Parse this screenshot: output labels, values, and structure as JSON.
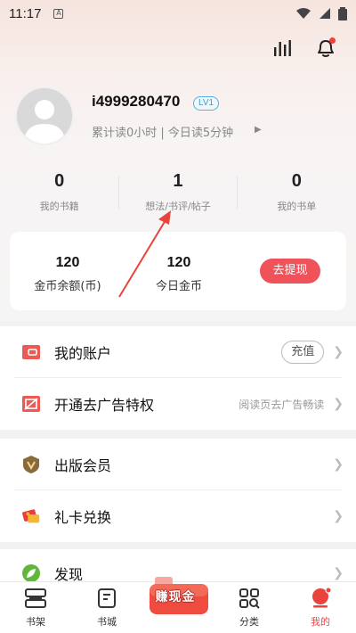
{
  "status_bar": {
    "time": "11:17",
    "indicator": "A"
  },
  "header": {
    "stats_icon": "bar-chart-icon",
    "bell_icon": "bell-icon"
  },
  "profile": {
    "username": "i4999280470",
    "level": "LV1",
    "read_info": "累计读0小时 | 今日读5分钟",
    "avatar_icon": "default-avatar"
  },
  "stats": [
    {
      "value": "0",
      "label": "我的书籍"
    },
    {
      "value": "1",
      "label": "想法/书评/帖子"
    },
    {
      "value": "0",
      "label": "我的书单"
    }
  ],
  "coins": {
    "balance_value": "120",
    "balance_label": "金币余额(币)",
    "today_value": "120",
    "today_label": "今日金币",
    "withdraw_label": "去提现"
  },
  "menu": {
    "group1": [
      {
        "label": "我的账户",
        "action": "充值",
        "icon": "wallet-icon"
      },
      {
        "label": "开通去广告特权",
        "hint": "阅读页去广告畅读",
        "icon": "no-ads-icon"
      }
    ],
    "group2": [
      {
        "label": "出版会员",
        "icon": "vip-shield-icon"
      },
      {
        "label": "礼卡兑换",
        "icon": "gift-card-icon"
      }
    ],
    "group3": [
      {
        "label": "发现",
        "icon": "leaf-icon"
      }
    ]
  },
  "tabbar": [
    {
      "label": "书架",
      "icon": "bookshelf-icon"
    },
    {
      "label": "书城",
      "icon": "bookstore-icon"
    },
    {
      "label": "赚现金",
      "icon": "earn-cash-icon"
    },
    {
      "label": "分类",
      "icon": "category-icon"
    },
    {
      "label": "我的",
      "icon": "profile-icon",
      "active": true
    }
  ],
  "colors": {
    "accent": "#f0525a",
    "active_tab": "#e84949",
    "level_badge": "#3c9fd1"
  }
}
